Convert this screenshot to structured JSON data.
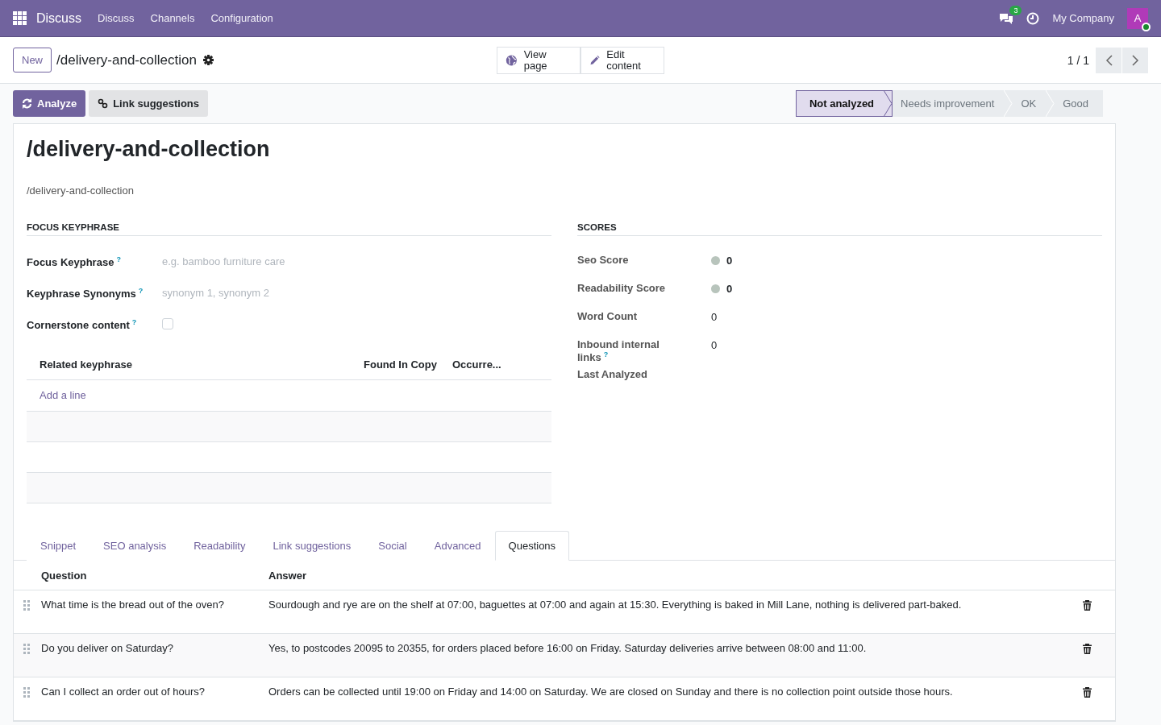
{
  "navbar": {
    "app_name": "Discuss",
    "menu": [
      "Discuss",
      "Channels",
      "Configuration"
    ],
    "chat_badge": "3",
    "company": "My Company",
    "avatar": "A"
  },
  "breadcrumb": {
    "new_button": "New",
    "title": "/delivery-and-collection"
  },
  "actions": [
    {
      "kind": "view",
      "label": "View page"
    },
    {
      "kind": "edit",
      "label": "Edit content"
    }
  ],
  "pager": "1 / 1",
  "buttons": [
    {
      "kind": "primary",
      "label": "Analyze"
    },
    {
      "kind": "secondary",
      "label": "Link suggestions"
    }
  ],
  "stages": [
    {
      "label": "Not analyzed",
      "selected": true
    },
    {
      "label": "Needs improvement",
      "selected": false
    },
    {
      "label": "OK",
      "selected": false
    },
    {
      "label": "Good",
      "selected": false
    }
  ],
  "sheet": {
    "title": "/delivery-and-collection",
    "url": "/delivery-and-collection",
    "focus": {
      "heading": "FOCUS KEYPHRASE",
      "fields": [
        {
          "kind": "text",
          "label": "Focus Keyphrase",
          "help": "?",
          "placeholder": "e.g. bamboo furniture care"
        },
        {
          "kind": "text",
          "label": "Keyphrase Synonyms",
          "help": "?",
          "placeholder": "synonym 1, synonym 2"
        },
        {
          "kind": "checkbox",
          "label": "Cornerstone content",
          "help": "?",
          "checked": false
        }
      ],
      "table": {
        "columns": [
          "Related keyphrase",
          "Found In Copy",
          "Occurre..."
        ],
        "add_line": "Add a line"
      }
    },
    "scores": {
      "heading": "SCORES",
      "rows": [
        {
          "kind": "dot",
          "label": "Seo Score",
          "value": "0"
        },
        {
          "kind": "dot",
          "label": "Readability Score",
          "value": "0"
        },
        {
          "kind": "plain",
          "label": "Word Count",
          "value": "0"
        },
        {
          "kind": "plain",
          "label": "Inbound internal links",
          "help": "?",
          "value": "0"
        },
        {
          "kind": "plain",
          "label": "Last Analyzed"
        }
      ]
    },
    "tabs": [
      {
        "label": "Snippet",
        "selected": false
      },
      {
        "label": "SEO analysis",
        "selected": false
      },
      {
        "label": "Readability",
        "selected": false
      },
      {
        "label": "Link suggestions",
        "selected": false
      },
      {
        "label": "Social",
        "selected": false
      },
      {
        "label": "Advanced",
        "selected": false
      },
      {
        "label": "Questions",
        "selected": true
      }
    ],
    "questions": {
      "columns": [
        "Question",
        "Answer"
      ],
      "rows": [
        {
          "question": "What time is the bread out of the oven?",
          "answer": "Sourdough and rye are on the shelf at 07:00, baguettes at 07:00 and again at 15:30. Everything is baked in Mill Lane, nothing is delivered part-baked."
        },
        {
          "question": "Do you deliver on Saturday?",
          "answer": "Yes, to postcodes 20095 to 20355, for orders placed before 16:00 on Friday. Saturday deliveries arrive between 08:00 and 11:00."
        },
        {
          "question": "Can I collect an order out of hours?",
          "answer": "Orders can be collected until 19:00 on Friday and 14:00 on Saturday. We are closed on Sunday and there is no collection point outside those hours."
        }
      ]
    }
  }
}
